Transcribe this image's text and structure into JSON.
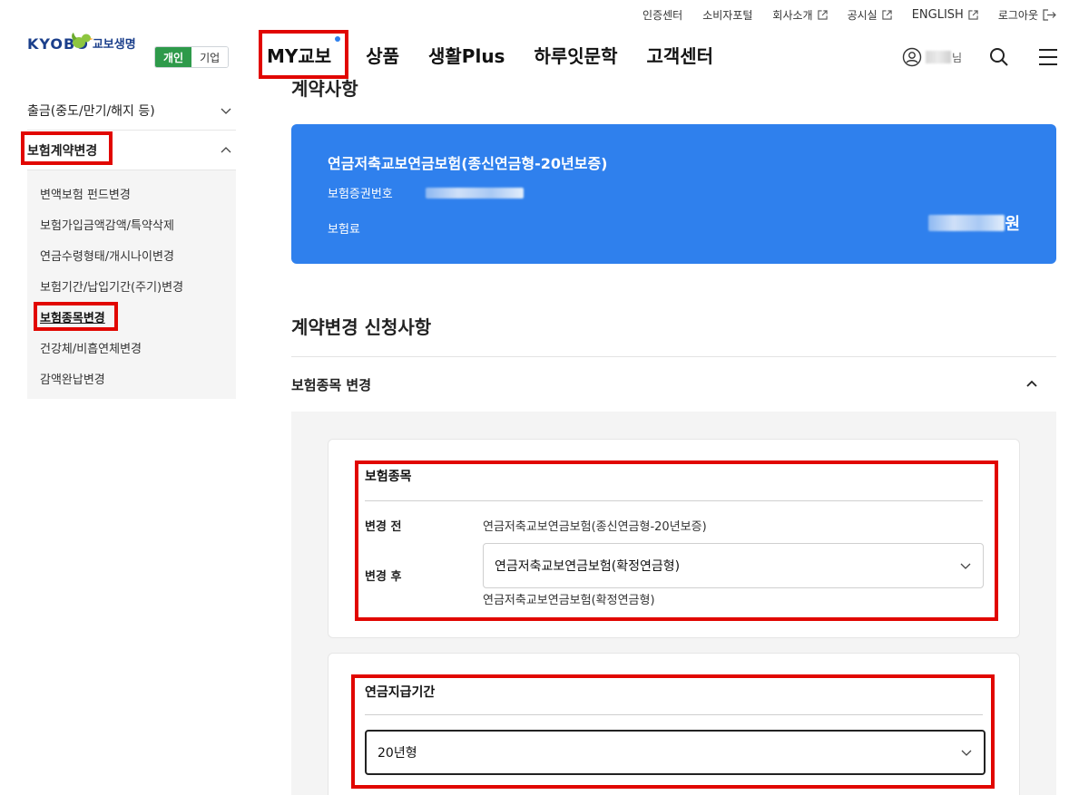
{
  "util_bar": {
    "items": [
      {
        "label": "인증센터",
        "external": false
      },
      {
        "label": "소비자포털",
        "external": false
      },
      {
        "label": "회사소개",
        "external": true
      },
      {
        "label": "공시실",
        "external": true
      },
      {
        "label": "ENGLISH",
        "external": true
      },
      {
        "label": "로그아웃",
        "external": false
      }
    ]
  },
  "header": {
    "logo_text": "KYOBO",
    "logo_kr": "교보생명",
    "segment": {
      "personal": "개인",
      "corporate": "기업"
    },
    "gnb": [
      "MY교보",
      "상품",
      "생활Plus",
      "하루잇문학",
      "고객센터"
    ],
    "user_suffix": "님",
    "accent_color": "#2f80ed",
    "brand_color": "#1b3f8b",
    "green_color": "#2e9a4a"
  },
  "sidebar": {
    "categories": [
      {
        "label": "출금(중도/만기/해지 등)",
        "expanded": false
      },
      {
        "label": "보험계약변경",
        "expanded": true
      }
    ],
    "sub_items": [
      "변액보험 펀드변경",
      "보험가입금액감액/특약삭제",
      "연금수령형태/개시나이변경",
      "보험기간/납입기간(주기)변경",
      "보험종목변경",
      "건강체/비흡연체변경",
      "감액완납변경"
    ],
    "active_sub": "보험종목변경"
  },
  "main": {
    "partial_title": "계약사항",
    "contract": {
      "product_name": "연금저축교보연금보험(종신연금형-20년보증)",
      "policy_label": "보험증권번호",
      "premium_label": "보험료",
      "premium_unit": "원"
    },
    "section_title": "계약변경 신청사항",
    "accordion_title": "보험종목 변경",
    "box1": {
      "title": "보험종목",
      "before_label": "변경 전",
      "before_value": "연금저축교보연금보험(종신연금형-20년보증)",
      "after_label": "변경 후",
      "after_selected": "연금저축교보연금보험(확정연금형)",
      "after_value_text": "연금저축교보연금보험(확정연금형)"
    },
    "box2": {
      "title": "연금지급기간",
      "selected": "20년형"
    }
  }
}
